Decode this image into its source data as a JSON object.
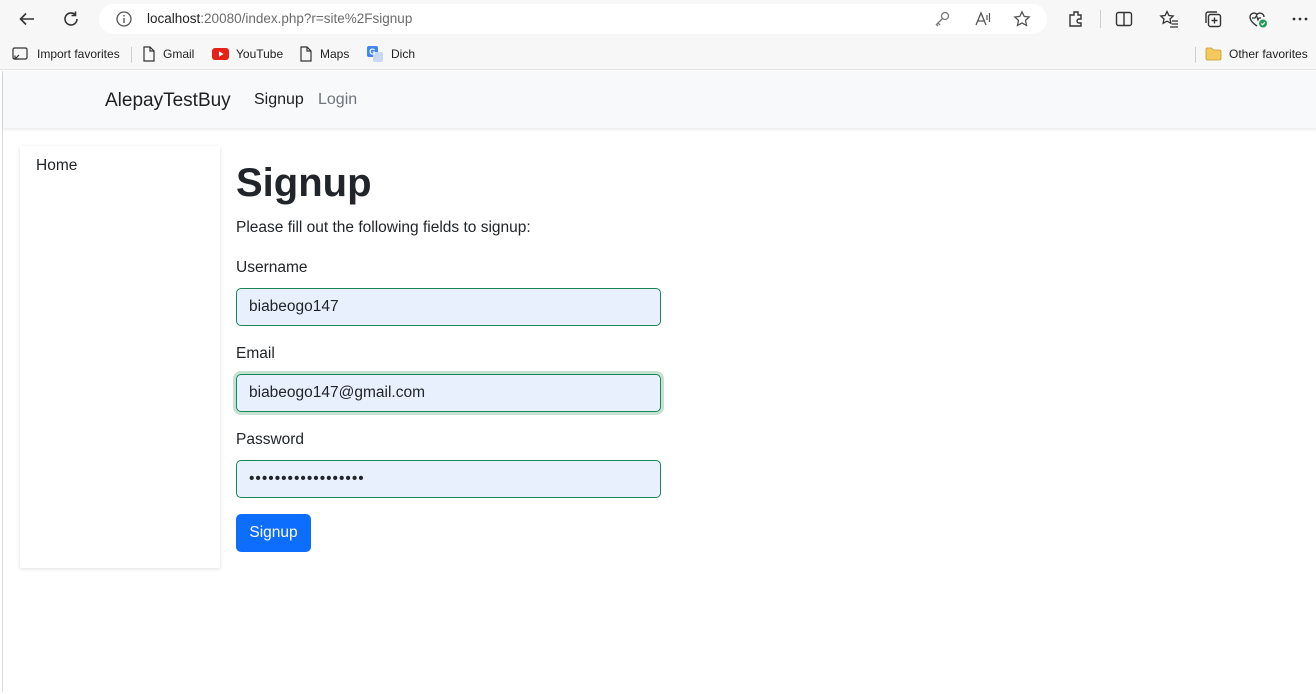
{
  "browser": {
    "url_host": "localhost",
    "url_rest": ":20080/index.php?r=site%2Fsignup"
  },
  "bookmarks": {
    "items": [
      {
        "label": "Import favorites",
        "icon": "import-icon"
      },
      {
        "label": "Gmail",
        "icon": "page-icon"
      },
      {
        "label": "YouTube",
        "icon": "youtube-icon"
      },
      {
        "label": "Maps",
        "icon": "page-icon"
      },
      {
        "label": "Dich",
        "icon": "translate-icon"
      }
    ],
    "other": "Other favorites"
  },
  "navbar": {
    "brand": "AlepayTestBuy",
    "links": [
      "Signup",
      "Login"
    ]
  },
  "sidebar": {
    "items": [
      "Home"
    ]
  },
  "main": {
    "title": "Signup",
    "lead": "Please fill out the following fields to signup:",
    "username_label": "Username",
    "username_value": "biabeogo147",
    "email_label": "Email",
    "email_value": "biabeogo147@gmail.com",
    "password_label": "Password",
    "password_value": "••••••••••••••••••",
    "submit_label": "Signup"
  },
  "colors": {
    "primary": "#0d6efd",
    "valid_border": "#198754",
    "autofill_bg": "#e8f0fe"
  }
}
